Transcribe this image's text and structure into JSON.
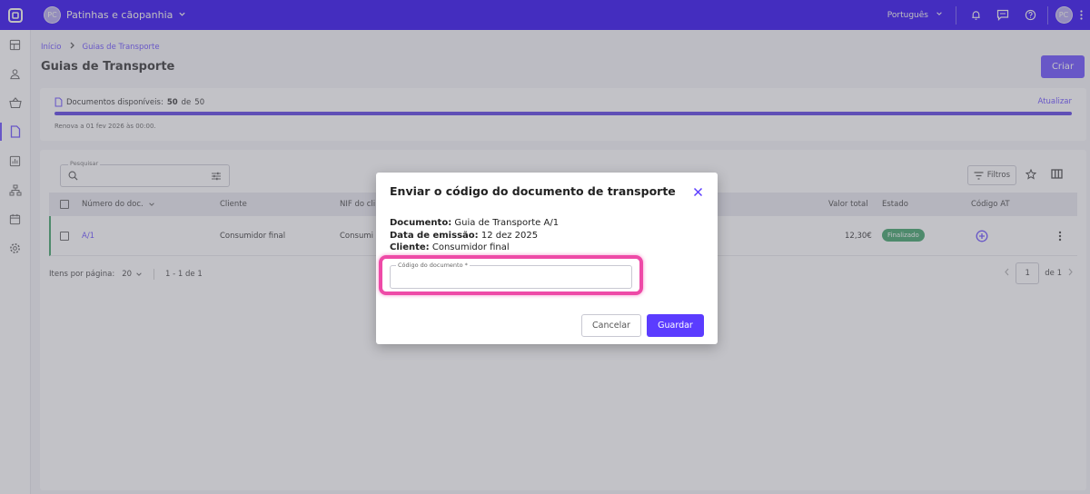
{
  "topbar": {
    "company_initials": "PC",
    "company_name": "Patinhas e cãopanhia",
    "language": "Português",
    "user_initials": "PC"
  },
  "breadcrumb": {
    "home": "Início",
    "current": "Guias de Transporte"
  },
  "page": {
    "title": "Guias de Transporte",
    "create_label": "Criar"
  },
  "quota": {
    "label": "Documentos disponíveis:",
    "used": "50",
    "separator": "de",
    "total": "50",
    "fill_fraction": 1.0,
    "refresh_label": "Atualizar",
    "renew_text": "Renova a 01 fev 2026 às 00:00."
  },
  "search": {
    "label": "Pesquisar",
    "placeholder": ""
  },
  "toolbar": {
    "filters_label": "Filtros"
  },
  "table": {
    "headers": {
      "doc_number": "Número do doc.",
      "client": "Cliente",
      "nif": "NIF do cli",
      "total": "Valor total",
      "status": "Estado",
      "at_code": "Código AT"
    },
    "rows": [
      {
        "doc_number": "A/1",
        "client": "Consumidor final",
        "nif": "Consumi",
        "total": "12,30€",
        "status": "Finalizado"
      }
    ]
  },
  "pagination": {
    "per_page_label": "Itens por página:",
    "per_page_value": "20",
    "range": "1 - 1 de 1",
    "page": "1",
    "of_pages": "de 1"
  },
  "modal": {
    "title": "Enviar o código do documento de transporte",
    "document_label": "Documento:",
    "document_value": "Guia de Transporte A/1",
    "issue_date_label": "Data de emissão:",
    "issue_date_value": "12 dez 2025",
    "client_label": "Cliente:",
    "client_value": "Consumidor final",
    "field_label": "Código do documento *",
    "field_value": "",
    "cancel_label": "Cancelar",
    "save_label": "Guardar"
  },
  "colors": {
    "primary": "#5b3cff",
    "success": "#2d9a5a",
    "highlight": "#ee4aa7"
  }
}
